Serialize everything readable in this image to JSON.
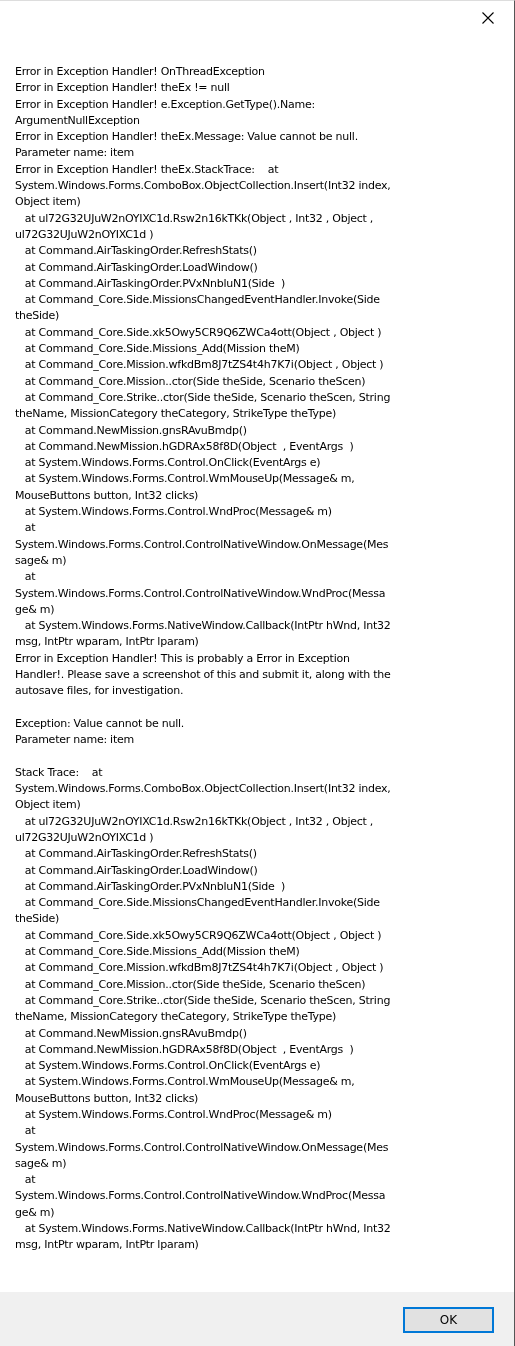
{
  "message_blocks": [
    {
      "text": "Error in Exception Handler! OnThreadException\nError in Exception Handler! theEx != null\nError in Exception Handler! e.Exception.GetType().Name:\nArgumentNullException\nError in Exception Handler! theEx.Message: Value cannot be null.\nParameter name: item\nError in Exception Handler! theEx.StackTrace:    at\nSystem.Windows.Forms.ComboBox.ObjectCollection.Insert(Int32 index,\nObject item)\n   at ul72G32UJuW2nOYIXC1d.Rsw2n16kTKk(Object , Int32 , Object ,\nul72G32UJuW2nOYIXC1d )\n   at Command.AirTaskingOrder.RefreshStats()\n   at Command.AirTaskingOrder.LoadWindow()\n   at Command.AirTaskingOrder.PVxNnbluN1(Side  )\n   at Command_Core.Side.MissionsChangedEventHandler.Invoke(Side\ntheSide)\n   at Command_Core.Side.xk5Owy5CR9Q6ZWCa4ott(Object , Object )\n   at Command_Core.Side.Missions_Add(Mission theM)\n   at Command_Core.Mission.wfkdBm8J7tZS4t4h7K7i(Object , Object )\n   at Command_Core.Mission..ctor(Side theSide, Scenario theScen)\n   at Command_Core.Strike..ctor(Side theSide, Scenario theScen, String\ntheName, MissionCategory theCategory, StrikeType theType)\n   at Command.NewMission.gnsRAvuBmdp()\n   at Command.NewMission.hGDRAx58f8D(Object  , EventArgs  )\n   at System.Windows.Forms.Control.OnClick(EventArgs e)\n   at System.Windows.Forms.Control.WmMouseUp(Message& m,\nMouseButtons button, Int32 clicks)\n   at System.Windows.Forms.Control.WndProc(Message& m)\n   at\nSystem.Windows.Forms.Control.ControlNativeWindow.OnMessage(Mes\nsage& m)\n   at\nSystem.Windows.Forms.Control.ControlNativeWindow.WndProc(Messa\nge& m)\n   at System.Windows.Forms.NativeWindow.Callback(IntPtr hWnd, Int32\nmsg, IntPtr wparam, IntPtr lparam)\nError in Exception Handler! This is probably a Error in Exception\nHandler!. Please save a screenshot of this and submit it, along with the\nautosave files, for investigation."
    },
    {
      "text": "Exception: Value cannot be null.\nParameter name: item"
    },
    {
      "text": "Stack Trace:    at\nSystem.Windows.Forms.ComboBox.ObjectCollection.Insert(Int32 index,\nObject item)\n   at ul72G32UJuW2nOYIXC1d.Rsw2n16kTKk(Object , Int32 , Object ,\nul72G32UJuW2nOYIXC1d )\n   at Command.AirTaskingOrder.RefreshStats()\n   at Command.AirTaskingOrder.LoadWindow()\n   at Command.AirTaskingOrder.PVxNnbluN1(Side  )\n   at Command_Core.Side.MissionsChangedEventHandler.Invoke(Side\ntheSide)\n   at Command_Core.Side.xk5Owy5CR9Q6ZWCa4ott(Object , Object )\n   at Command_Core.Side.Missions_Add(Mission theM)\n   at Command_Core.Mission.wfkdBm8J7tZS4t4h7K7i(Object , Object )\n   at Command_Core.Mission..ctor(Side theSide, Scenario theScen)\n   at Command_Core.Strike..ctor(Side theSide, Scenario theScen, String\ntheName, MissionCategory theCategory, StrikeType theType)\n   at Command.NewMission.gnsRAvuBmdp()\n   at Command.NewMission.hGDRAx58f8D(Object  , EventArgs  )\n   at System.Windows.Forms.Control.OnClick(EventArgs e)\n   at System.Windows.Forms.Control.WmMouseUp(Message& m,\nMouseButtons button, Int32 clicks)\n   at System.Windows.Forms.Control.WndProc(Message& m)\n   at\nSystem.Windows.Forms.Control.ControlNativeWindow.OnMessage(Mes\nsage& m)\n   at\nSystem.Windows.Forms.Control.ControlNativeWindow.WndProc(Messa\nge& m)\n   at System.Windows.Forms.NativeWindow.Callback(IntPtr hWnd, Int32\nmsg, IntPtr wparam, IntPtr lparam)"
    }
  ],
  "buttons": [
    {
      "label": "OK",
      "selected": true
    }
  ]
}
